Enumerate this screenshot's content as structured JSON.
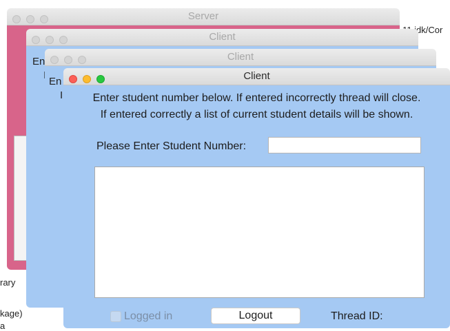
{
  "background": {
    "top_right_text": "11.jdk/Cor",
    "left_texts": [
      "rary",
      "kage)",
      "a"
    ]
  },
  "windows": {
    "server": {
      "title": "Server"
    },
    "client_back": {
      "title": "Client",
      "peek_top": "En",
      "peek_next": "I"
    },
    "client_mid": {
      "title": "Client",
      "peek_top": "En",
      "peek_next": "I"
    },
    "client_front": {
      "title": "Client",
      "instructions": {
        "line1": "Enter student number below. If entered incorrectly thread will close.",
        "line2": "If entered correctly a list of current student details will be shown."
      },
      "prompt_label": "Please Enter Student Number:",
      "student_number_value": "",
      "output_text": "",
      "logged_in_label": "Logged in",
      "logged_in_checked": false,
      "logout_label": "Logout",
      "thread_id_label": "Thread ID:"
    }
  },
  "colors": {
    "client_bg": "#a5c9f3",
    "server_bg": "#d8648a",
    "close": "#fc5f57",
    "minimize": "#fdbc2e",
    "zoom": "#28c840"
  }
}
